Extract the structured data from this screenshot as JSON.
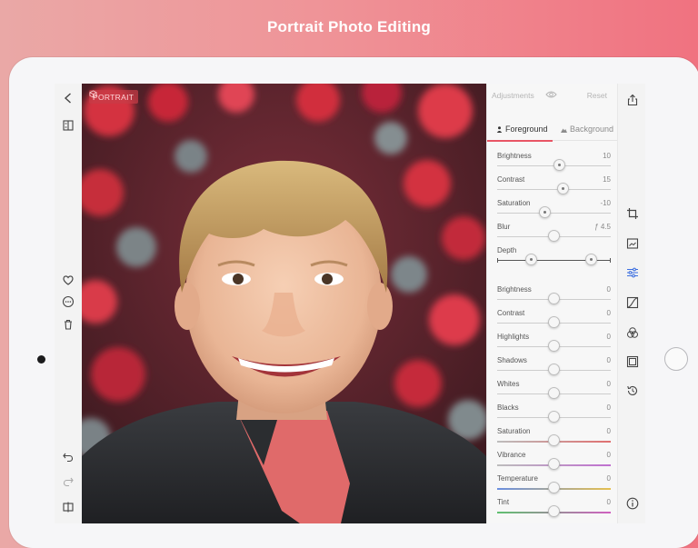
{
  "headline": "Portrait Photo Editing",
  "photo": {
    "badge_label": "PORTRAIT"
  },
  "panel": {
    "title": "Adjustments",
    "reset_label": "Reset",
    "tabs": [
      {
        "label": "Foreground",
        "icon": "person-icon",
        "active": true
      },
      {
        "label": "Background",
        "icon": "mountain-icon",
        "active": false
      }
    ],
    "depth_sliders": [
      {
        "label": "Brightness",
        "value": "10",
        "position": 0.55
      },
      {
        "label": "Contrast",
        "value": "15",
        "position": 0.58
      },
      {
        "label": "Saturation",
        "value": "-10",
        "position": 0.42
      },
      {
        "label": "Blur",
        "value": "ƒ 4.5",
        "position": 0.5
      },
      {
        "label": "Depth",
        "value": "",
        "range": [
          0.3,
          0.83
        ]
      }
    ],
    "global_sliders": [
      {
        "label": "Brightness",
        "value": "0",
        "position": 0.5
      },
      {
        "label": "Contrast",
        "value": "0",
        "position": 0.5
      },
      {
        "label": "Highlights",
        "value": "0",
        "position": 0.5
      },
      {
        "label": "Shadows",
        "value": "0",
        "position": 0.5
      },
      {
        "label": "Whites",
        "value": "0",
        "position": 0.5
      },
      {
        "label": "Blacks",
        "value": "0",
        "position": 0.5
      },
      {
        "label": "Saturation",
        "value": "0",
        "position": 0.5,
        "gradient": "linear-gradient(90deg,#bdbdbd,#e07070)"
      },
      {
        "label": "Vibrance",
        "value": "0",
        "position": 0.5,
        "gradient": "linear-gradient(90deg,#bdbdbd,#c070d0)"
      },
      {
        "label": "Temperature",
        "value": "0",
        "position": 0.5,
        "gradient": "linear-gradient(90deg,#6a8fe0,#e6c050)"
      },
      {
        "label": "Tint",
        "value": "0",
        "position": 0.5,
        "gradient": "linear-gradient(90deg,#60c070,#d060c0)"
      }
    ]
  },
  "left_toolbar": {
    "icons": [
      "back-icon",
      "compare-icon",
      "heart-icon",
      "more-icon",
      "trash-icon",
      "undo-icon",
      "redo-icon",
      "split-view-icon"
    ]
  },
  "right_toolbar": {
    "icons": [
      "share-icon",
      "crop-icon",
      "frame-icon",
      "adjust-icon",
      "curves-icon",
      "color-mix-icon",
      "vignette-icon",
      "history-icon",
      "info-icon"
    ]
  },
  "colors": {
    "accent": "#e85565",
    "background_gradient_start": "#eaa8a6",
    "background_gradient_end": "#f07280"
  }
}
